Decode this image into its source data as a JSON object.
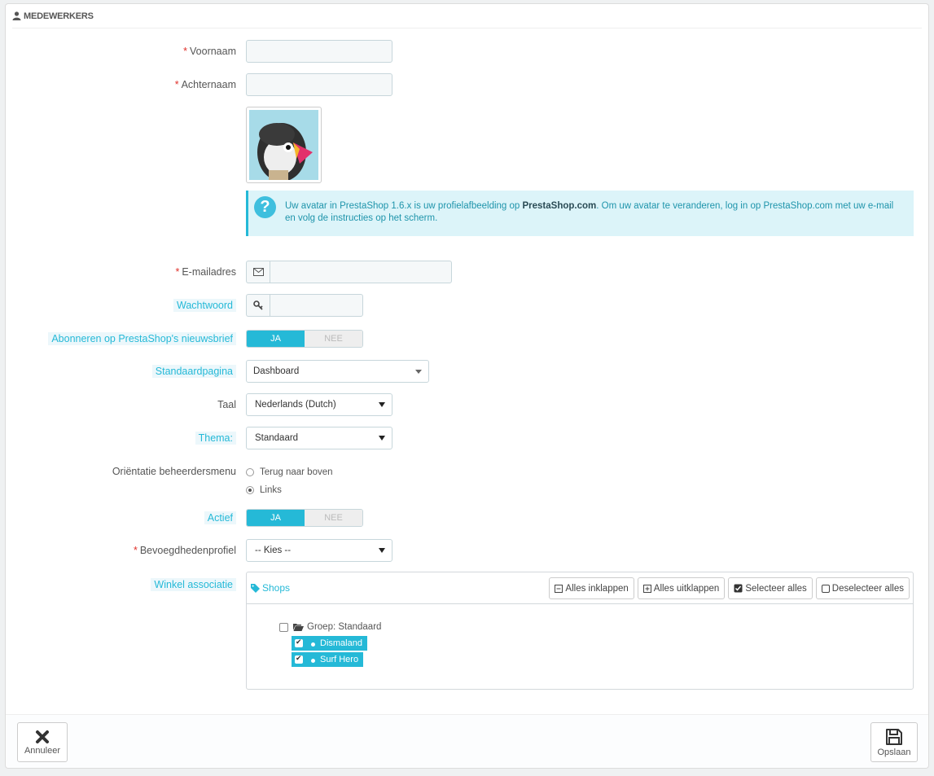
{
  "panel": {
    "title": "MEDEWERKERS"
  },
  "form": {
    "firstname_label": "Voornaam",
    "lastname_label": "Achternaam",
    "avatar_info": {
      "text_before": "Uw avatar in PrestaShop 1.6.x is uw profielafbeelding op ",
      "brand": "PrestaShop.com",
      "text_after": ". Om uw avatar te veranderen, log in op PrestaShop.com met uw e-mail en volg de instructies op het scherm."
    },
    "email_label": "E-mailadres",
    "password_label": "Wachtwoord",
    "newsletter_label": "Abonneren op PrestaShop's nieuwsbrief",
    "newsletter_switch": {
      "on": "JA",
      "off": "NEE",
      "value": "JA"
    },
    "default_page_label": "Standaardpagina",
    "default_page_value": "Dashboard",
    "language_label": "Taal",
    "language_value": "Nederlands (Dutch)",
    "theme_label": "Thema:",
    "theme_value": "Standaard",
    "menu_orientation_label": "Oriëntatie beheerdersmenu",
    "menu_orientation_options": [
      "Terug naar boven",
      "Links"
    ],
    "menu_orientation_selected": "Links",
    "active_label": "Actief",
    "active_switch": {
      "on": "JA",
      "off": "NEE",
      "value": "JA"
    },
    "profile_label": "Bevoegdhedenprofiel",
    "profile_value": "-- Kies --",
    "shop_assoc_label": "Winkel associatie"
  },
  "shop_tree": {
    "title": "Shops",
    "buttons": {
      "collapse_all": "Alles inklappen",
      "expand_all": "Alles uitklappen",
      "select_all": "Selecteer alles",
      "deselect_all": "Deselecteer alles"
    },
    "group_label": "Groep: Standaard",
    "shops": [
      {
        "name": "Dismaland",
        "checked": true
      },
      {
        "name": "Surf Hero",
        "checked": true
      }
    ]
  },
  "footer": {
    "cancel_label": "Annuleer",
    "save_label": "Opslaan"
  },
  "colors": {
    "accent": "#25b9d7",
    "required": "#e0302a",
    "info_bg": "#dcf4f9"
  }
}
